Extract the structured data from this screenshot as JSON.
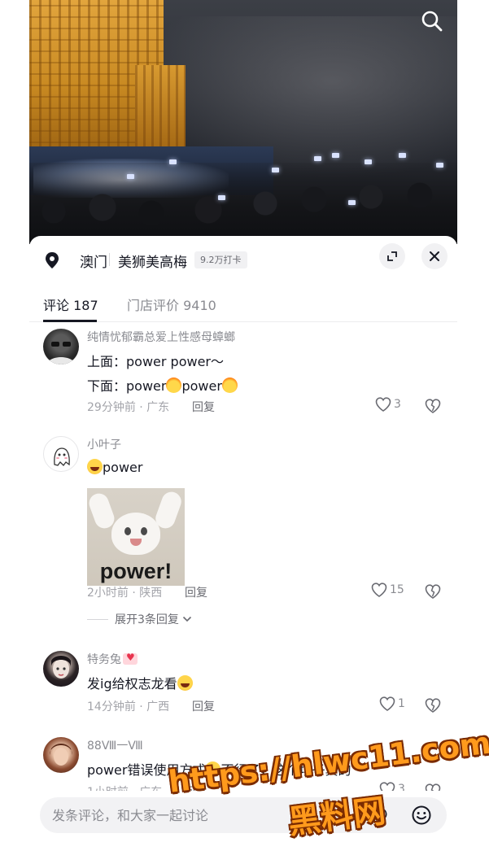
{
  "location": {
    "city": "澳门",
    "place": "美狮美高梅",
    "checkins": "9.2万打卡"
  },
  "tabs": {
    "comments": "评论 187",
    "reviews": "门店评价 9410"
  },
  "comments": [
    {
      "user": "纯情忧郁霸总爱上性感母蟑螂",
      "lines": [
        "上面：power power～",
        "下面：power",
        "power"
      ],
      "meta": "29分钟前 · 广东",
      "reply": "回复",
      "likes": "3",
      "emoji": "fire-emoji"
    },
    {
      "user": "小叶子",
      "text": "power",
      "sticker_text": "power!",
      "meta": "2小时前 · 陕西",
      "reply": "回复",
      "likes": "15",
      "expand": "展开3条回复",
      "emoji": "laugh-cry-emoji"
    },
    {
      "user": "特务兔",
      "text": "发ig给权志龙看",
      "meta": "14分钟前 · 广西",
      "reply": "回复",
      "likes": "1",
      "emoji": "laugh-cry-emoji"
    },
    {
      "user": "88Ⅷ一Ⅷ",
      "text_before": "power错误使用方式",
      "text_after": "不行了，这个场子真的",
      "meta": "1小时前 · 广东",
      "reply": "回复",
      "likes": "3",
      "emoji": "shy-emoji"
    }
  ],
  "input": {
    "placeholder": "发条评论，和大家一起讨论"
  },
  "watermark": {
    "url": "https://hlwc11.com",
    "name": "黑料网"
  },
  "icons": [
    "search-icon",
    "location-pin-icon",
    "expand-icon",
    "close-icon",
    "heart-icon",
    "dislike-icon",
    "chevron-down-icon",
    "at-icon",
    "emoji-icon"
  ],
  "colors": {
    "text_primary": "#161823",
    "text_secondary": "#8a8b91",
    "watermark": "#ff9a1c"
  }
}
